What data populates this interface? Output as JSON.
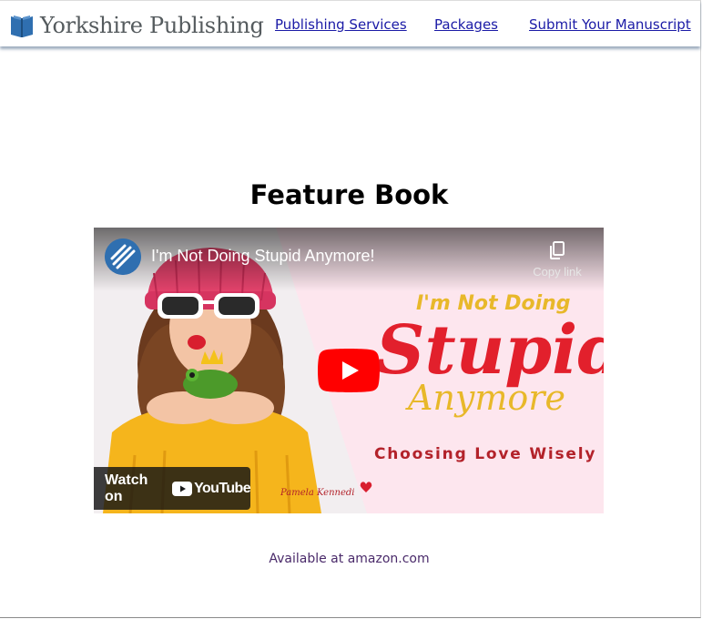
{
  "header": {
    "logo_text": "Yorkshire Publishing",
    "nav": [
      {
        "label": "Publishing Services"
      },
      {
        "label": "Packages"
      },
      {
        "label": "Submit Your Manuscript"
      }
    ]
  },
  "main": {
    "title": "Feature Book",
    "video": {
      "title": "I'm Not Doing Stupid Anymore!",
      "copy_link_label": "Copy link",
      "watch_on_label": "Watch on",
      "youtube_wordmark": "YouTube",
      "cover": {
        "line1": "I'm Not Doing",
        "line2": "Stupid",
        "line3": "Anymore",
        "subtitle": "Choosing Love Wisely",
        "author": "Pamela Kennedi"
      }
    },
    "availability": "Available at amazon.com"
  },
  "colors": {
    "nav_link": "#1a1aa6",
    "cover_pink": "#fde6ee",
    "cover_red": "#e2202c",
    "cover_gold": "#e8b82a",
    "youtube_red": "#ff0000",
    "sweater_yellow": "#f5b51c"
  },
  "icons": {
    "logo": "open-book-icon",
    "copy": "copy-icon",
    "play": "youtube-play-icon"
  }
}
